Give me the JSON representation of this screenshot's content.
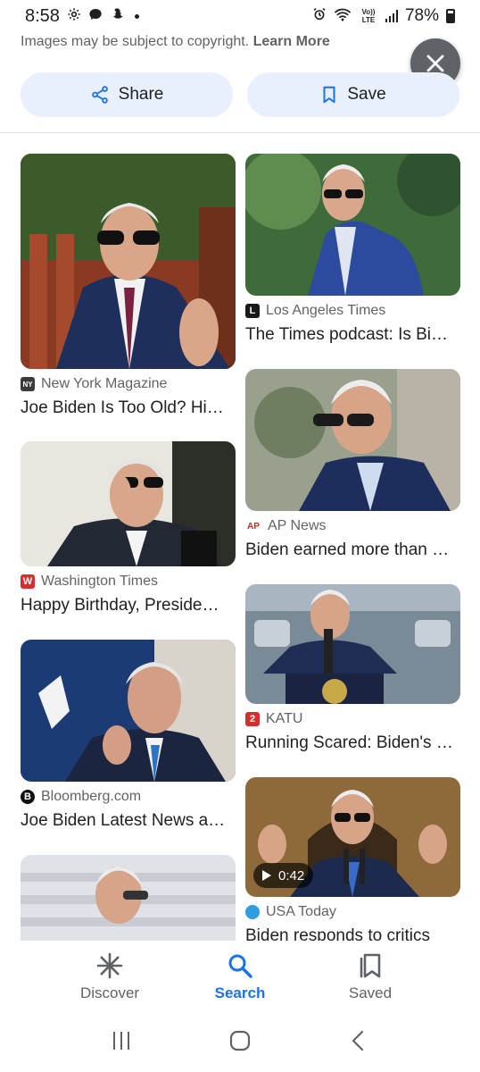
{
  "status_bar": {
    "time": "8:58",
    "network": "Vo)) LTE",
    "battery": "78%"
  },
  "banner": {
    "text": "Images may be subject to copyright.",
    "link": "Learn More"
  },
  "actions": {
    "share_label": "Share",
    "save_label": "Save"
  },
  "results": [
    {
      "source": "New York Magazine",
      "title": "Joe Biden Is Too Old? Hi…",
      "favicon": "NY",
      "favicon_color": "#3a3a3a"
    },
    {
      "source": "Los Angeles Times",
      "title": "The Times podcast: Is Bi…",
      "favicon": "L",
      "favicon_color": "#1a1a1a"
    },
    {
      "source": "AP News",
      "title": "Biden earned more than …",
      "favicon": "AP",
      "favicon_color": "#e31b23"
    },
    {
      "source": "Washington Times",
      "title": "Happy Birthday, Preside…",
      "favicon": "W",
      "favicon_color": "#d32f2f"
    },
    {
      "source": "KATU",
      "title": "Running Scared: Biden's …",
      "favicon": "2",
      "favicon_color": "#d32f2f"
    },
    {
      "source": "Bloomberg.com",
      "title": "Joe Biden Latest News a…",
      "favicon": "B",
      "favicon_color": "#111111"
    },
    {
      "source": "USA Today",
      "title": "Biden responds to critics",
      "favicon": "",
      "favicon_color": "#2e9de4",
      "duration": "0:42"
    },
    {
      "source": "",
      "title": ""
    }
  ],
  "bottom_nav": {
    "discover": "Discover",
    "search": "Search",
    "saved": "Saved"
  },
  "colors": {
    "accent": "#1a73e8",
    "button_bg": "#e8f0fe",
    "close_bg": "#5f6368"
  }
}
